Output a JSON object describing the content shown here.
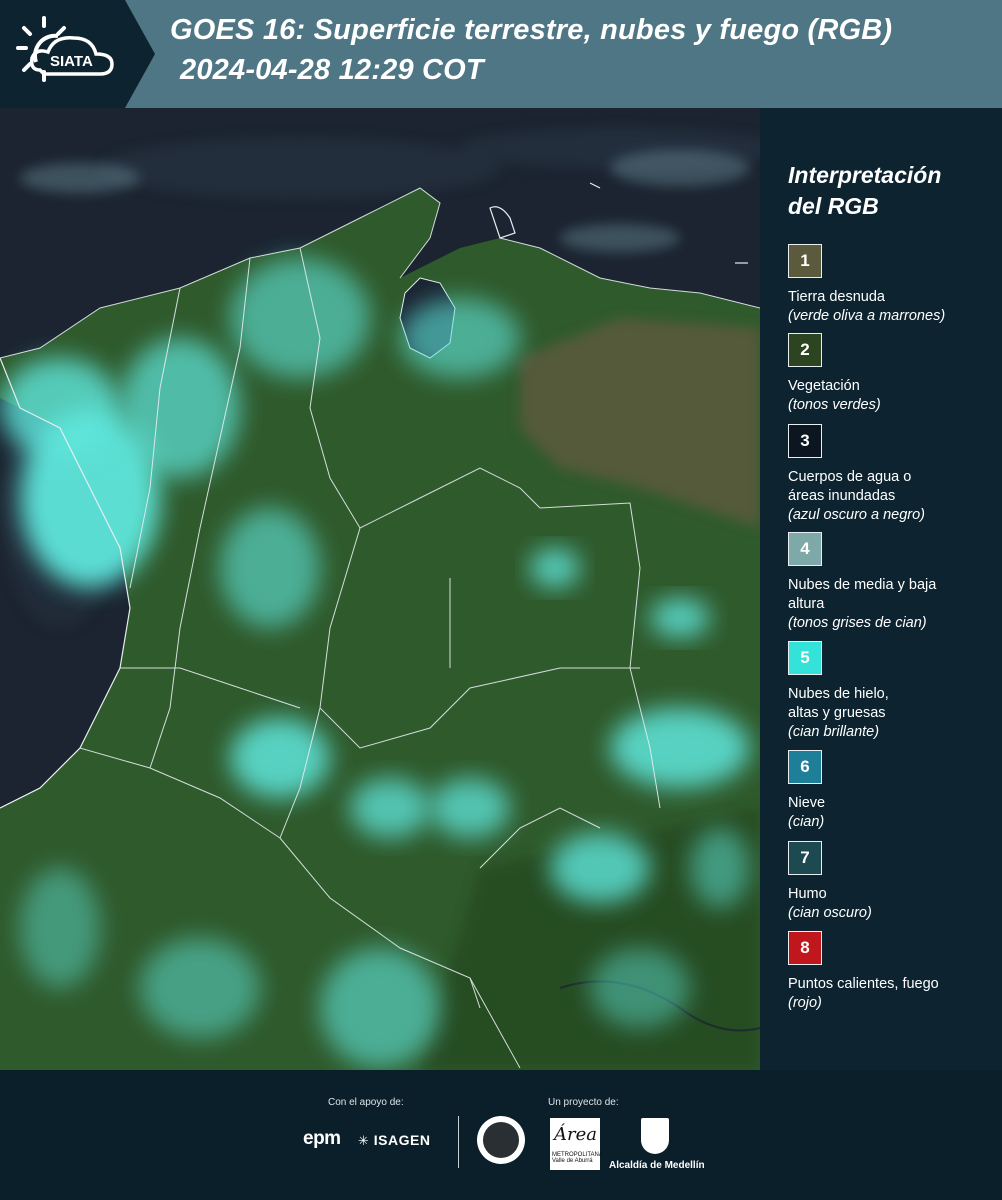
{
  "header": {
    "logo_text": "SIATA",
    "title": "GOES 16: Superficie terrestre, nubes y fuego (RGB)",
    "datetime": "2024-04-28 12:29 COT"
  },
  "legend": {
    "title_line1": "Interpretación",
    "title_line2": "del RGB",
    "items": [
      {
        "number": "1",
        "label": "Tierra desnuda",
        "desc": "(verde oliva a marrones)",
        "color": "#5b5a3c"
      },
      {
        "number": "2",
        "label": "Vegetación",
        "desc": "(tonos verdes)",
        "color": "#2c4420"
      },
      {
        "number": "3",
        "label": "Cuerpos de agua o áreas inundadas",
        "desc": "(azul oscuro a negro)",
        "color": "#0b1620"
      },
      {
        "number": "4",
        "label": "Nubes de media y baja altura",
        "desc": "(tonos grises de cian)",
        "color": "#7ea9a8"
      },
      {
        "number": "5",
        "label": "Nubes de hielo, altas y gruesas",
        "desc": "(cian brillante)",
        "color": "#33e3d9"
      },
      {
        "number": "6",
        "label": "Nieve",
        "desc": "(cian)",
        "color": "#1e7f98"
      },
      {
        "number": "7",
        "label": "Humo",
        "desc": "(cian oscuro)",
        "color": "#1c4a50"
      },
      {
        "number": "8",
        "label": "Puntos calientes, fuego",
        "desc": "(rojo)",
        "color": "#c0171c"
      }
    ]
  },
  "footer": {
    "support_label": "Con el apoyo de:",
    "project_label": "Un proyecto de:",
    "sponsor_epm": "epm",
    "sponsor_isagen": "ISAGEN",
    "area_logo_text": "Área",
    "area_logo_sub": "METROPOLITANA Valle de Aburrá",
    "alcaldia": "Alcaldía de Medellín"
  },
  "colors": {
    "header_bg": "#4f7685",
    "panel_bg": "#0d2430",
    "sea": "#1b2430",
    "land": "#2f5a2c",
    "cloud": "#5fe6dc",
    "border": "#e6edf0"
  }
}
